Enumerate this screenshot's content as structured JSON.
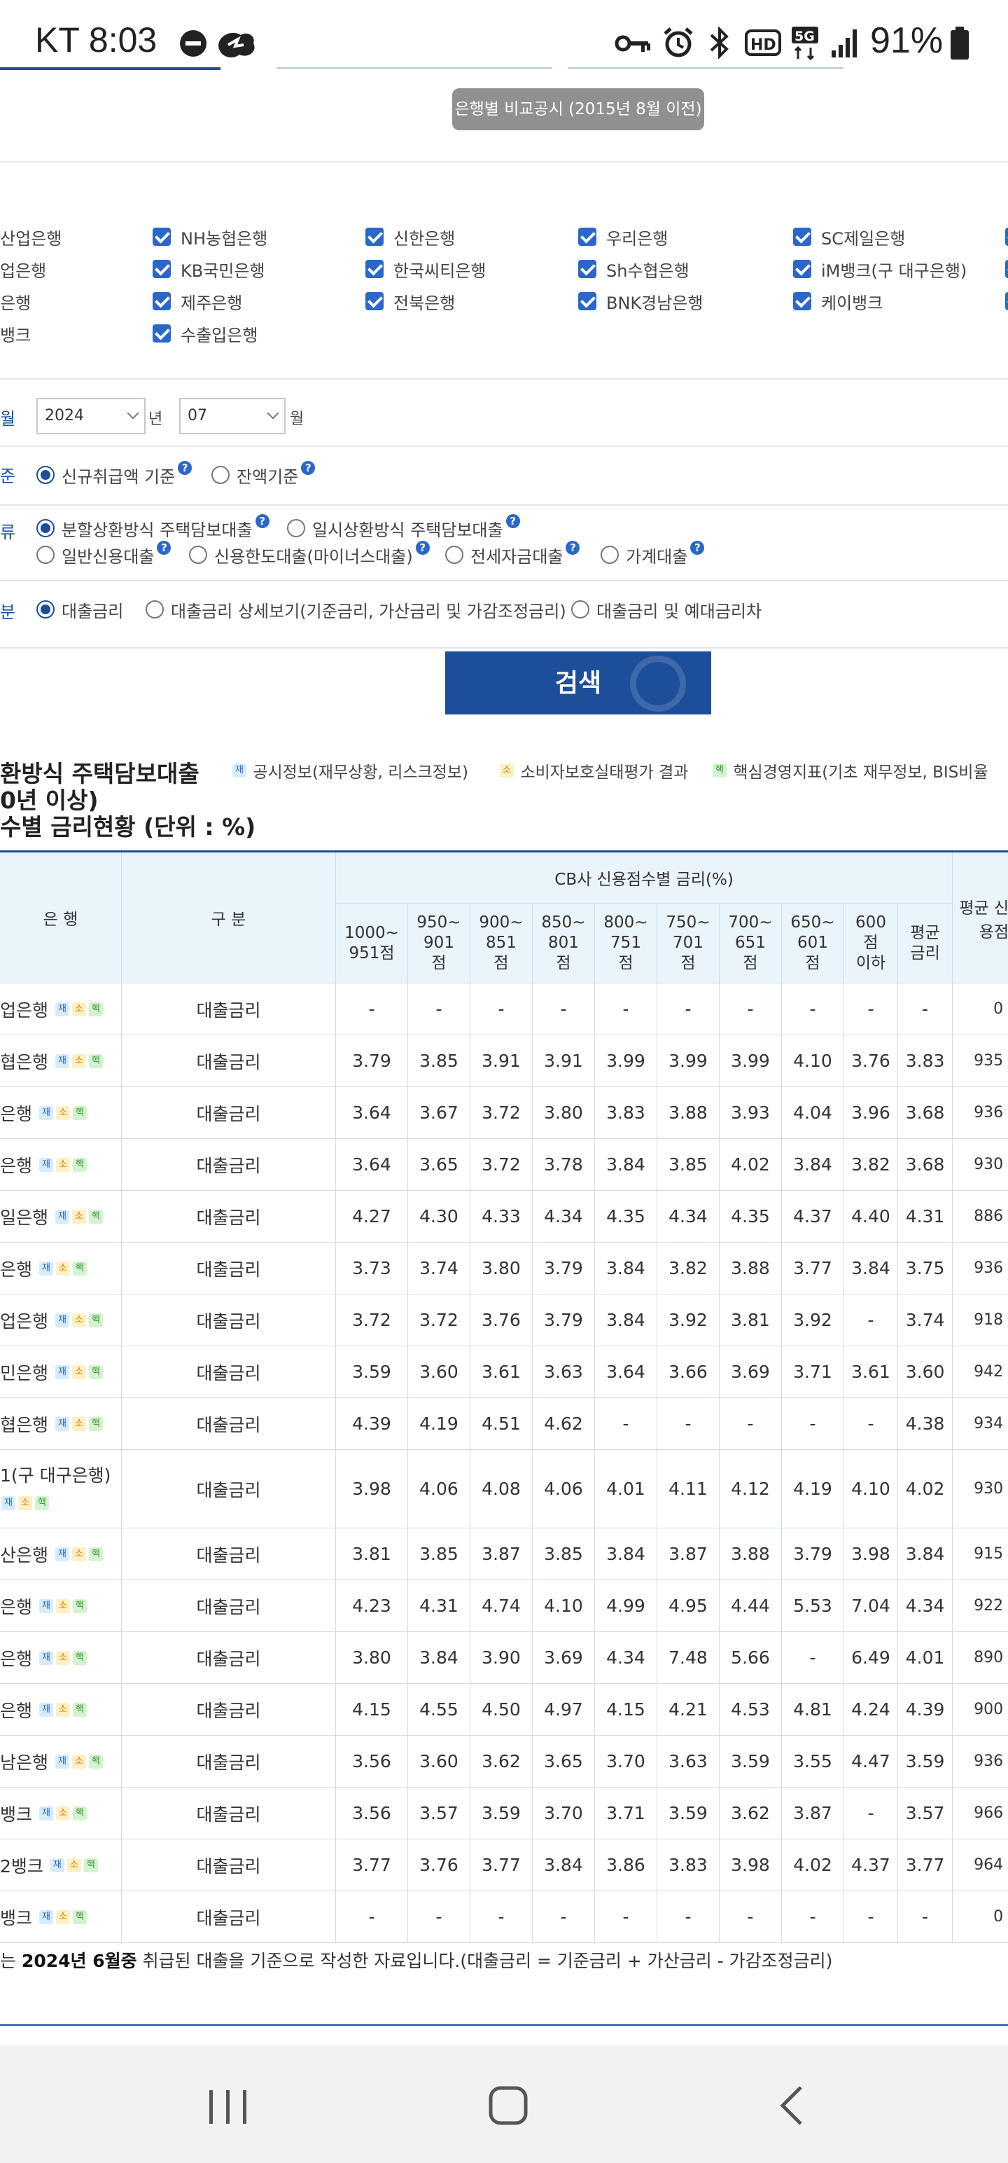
{
  "status_bar": {
    "carrier_time": "KT 8:03",
    "battery": "91%",
    "network": "5G"
  },
  "compare_badge": "은행별 비교공시 (2015년 8월 이전)",
  "banks": [
    [
      "산업은행",
      "NH농협은행",
      "신한은행",
      "우리은행",
      "SC제일은행"
    ],
    [
      "기업은행",
      "KB국민은행",
      "한국씨티은행",
      "Sh수협은행",
      "iM뱅크(구 대구은행)"
    ],
    [
      "부산은행",
      "제주은행",
      "전북은행",
      "BNK경남은행",
      "케이뱅크"
    ],
    [
      "토스뱅크",
      "수출입은행"
    ]
  ],
  "banks_visible": [
    [
      "산업은행",
      "NH농협은행",
      "신한은행",
      "우리은행",
      "SC제일은행"
    ],
    [
      "업은행",
      "KB국민은행",
      "한국씨티은행",
      "Sh수협은행",
      "iM뱅크(구 대구은행)"
    ],
    [
      "은행",
      "제주은행",
      "전북은행",
      "BNK경남은행",
      "케이뱅크"
    ],
    [
      "뱅크",
      "수출입은행"
    ]
  ],
  "period": {
    "label": "월",
    "year": "2024",
    "year_unit": "년",
    "month": "07",
    "month_unit": "월"
  },
  "basis": {
    "label": "준",
    "options": [
      "신규취급액 기준",
      "잔액기준"
    ],
    "selected": 0
  },
  "loan_type": {
    "label": "류",
    "options": [
      "분할상환방식 주택담보대출",
      "일시상환방식 주택담보대출",
      "일반신용대출",
      "신용한도대출(마이너스대출)",
      "전세자금대출",
      "가계대출"
    ],
    "selected": 0
  },
  "division": {
    "label": "분",
    "options": [
      "대출금리",
      "대출금리 상세보기(기준금리, 가산금리 및 가감조정금리)",
      "대출금리 및 예대금리차"
    ],
    "selected": 0
  },
  "search_button": "검색",
  "result_title": {
    "line1": "환방식 주택담보대출",
    "line2": "0년 이상)",
    "line3": "수별 금리현황 (단위 : %)"
  },
  "legend": [
    {
      "tag": "재",
      "text": "공시정보(재무상황, 리스크정보)"
    },
    {
      "tag": "소",
      "text": "소비자보호실태평가 결과"
    },
    {
      "tag": "핵",
      "text": "핵심경영지표(기초 재무정보, BIS비율"
    }
  ],
  "table": {
    "col_bank": "은 행",
    "col_division": "구 분",
    "col_group": "CB사 신용점수별 금리(%)",
    "col_avg_score": "평균 신용점",
    "score_cols": [
      "1000~ 951점",
      "950~ 901 점",
      "900~ 851 점",
      "850~ 801 점",
      "800~ 751 점",
      "750~ 701 점",
      "700~ 651 점",
      "650~ 601 점",
      "600 점 이하",
      "평균 금리"
    ],
    "rows": [
      {
        "bank": "업은행",
        "div": "대출금리",
        "v": [
          "-",
          "-",
          "-",
          "-",
          "-",
          "-",
          "-",
          "-",
          "-",
          "-"
        ],
        "score": "0"
      },
      {
        "bank": "협은행",
        "div": "대출금리",
        "v": [
          "3.79",
          "3.85",
          "3.91",
          "3.91",
          "3.99",
          "3.99",
          "3.99",
          "4.10",
          "3.76",
          "3.83"
        ],
        "score": "935"
      },
      {
        "bank": "은행",
        "div": "대출금리",
        "v": [
          "3.64",
          "3.67",
          "3.72",
          "3.80",
          "3.83",
          "3.88",
          "3.93",
          "4.04",
          "3.96",
          "3.68"
        ],
        "score": "936"
      },
      {
        "bank": "은행",
        "div": "대출금리",
        "v": [
          "3.64",
          "3.65",
          "3.72",
          "3.78",
          "3.84",
          "3.85",
          "4.02",
          "3.84",
          "3.82",
          "3.68"
        ],
        "score": "930"
      },
      {
        "bank": "일은행",
        "div": "대출금리",
        "v": [
          "4.27",
          "4.30",
          "4.33",
          "4.34",
          "4.35",
          "4.34",
          "4.35",
          "4.37",
          "4.40",
          "4.31"
        ],
        "score": "886"
      },
      {
        "bank": "은행",
        "div": "대출금리",
        "v": [
          "3.73",
          "3.74",
          "3.80",
          "3.79",
          "3.84",
          "3.82",
          "3.88",
          "3.77",
          "3.84",
          "3.75"
        ],
        "score": "936"
      },
      {
        "bank": "업은행",
        "div": "대출금리",
        "v": [
          "3.72",
          "3.72",
          "3.76",
          "3.79",
          "3.84",
          "3.92",
          "3.81",
          "3.92",
          "-",
          "3.74"
        ],
        "score": "918"
      },
      {
        "bank": "민은행",
        "div": "대출금리",
        "v": [
          "3.59",
          "3.60",
          "3.61",
          "3.63",
          "3.64",
          "3.66",
          "3.69",
          "3.71",
          "3.61",
          "3.60"
        ],
        "score": "942"
      },
      {
        "bank": "협은행",
        "div": "대출금리",
        "v": [
          "4.39",
          "4.19",
          "4.51",
          "4.62",
          "-",
          "-",
          "-",
          "-",
          "-",
          "4.38"
        ],
        "score": "934"
      },
      {
        "bank": "1(구 대구은행)",
        "div": "대출금리",
        "v": [
          "3.98",
          "4.06",
          "4.08",
          "4.06",
          "4.01",
          "4.11",
          "4.12",
          "4.19",
          "4.10",
          "4.02"
        ],
        "score": "930",
        "tall": true
      },
      {
        "bank": "산은행",
        "div": "대출금리",
        "v": [
          "3.81",
          "3.85",
          "3.87",
          "3.85",
          "3.84",
          "3.87",
          "3.88",
          "3.79",
          "3.98",
          "3.84"
        ],
        "score": "915"
      },
      {
        "bank": "은행",
        "div": "대출금리",
        "v": [
          "4.23",
          "4.31",
          "4.74",
          "4.10",
          "4.99",
          "4.95",
          "4.44",
          "5.53",
          "7.04",
          "4.34"
        ],
        "score": "922"
      },
      {
        "bank": "은행",
        "div": "대출금리",
        "v": [
          "3.80",
          "3.84",
          "3.90",
          "3.69",
          "4.34",
          "7.48",
          "5.66",
          "-",
          "6.49",
          "4.01"
        ],
        "score": "890"
      },
      {
        "bank": "은행",
        "div": "대출금리",
        "v": [
          "4.15",
          "4.55",
          "4.50",
          "4.97",
          "4.15",
          "4.21",
          "4.53",
          "4.81",
          "4.24",
          "4.39"
        ],
        "score": "900"
      },
      {
        "bank": "남은행",
        "div": "대출금리",
        "v": [
          "3.56",
          "3.60",
          "3.62",
          "3.65",
          "3.70",
          "3.63",
          "3.59",
          "3.55",
          "4.47",
          "3.59"
        ],
        "score": "936"
      },
      {
        "bank": "뱅크",
        "div": "대출금리",
        "v": [
          "3.56",
          "3.57",
          "3.59",
          "3.70",
          "3.71",
          "3.59",
          "3.62",
          "3.87",
          "-",
          "3.57"
        ],
        "score": "966"
      },
      {
        "bank": "2뱅크",
        "div": "대출금리",
        "v": [
          "3.77",
          "3.76",
          "3.77",
          "3.84",
          "3.86",
          "3.83",
          "3.98",
          "4.02",
          "4.37",
          "3.77"
        ],
        "score": "964"
      },
      {
        "bank": "뱅크",
        "div": "대출금리",
        "v": [
          "-",
          "-",
          "-",
          "-",
          "-",
          "-",
          "-",
          "-",
          "-",
          "-"
        ],
        "score": "0"
      }
    ]
  },
  "tags": {
    "a": "재",
    "b": "소",
    "c": "핵"
  },
  "footnote": {
    "pre": "는 ",
    "bold": "2024년 6월중",
    "post": " 취급된 대출을 기준으로 작성한 자료입니다.(대출금리 = 기준금리 + 가산금리 - 가감조정금리)"
  },
  "colors": {
    "primary": "#1d4e9a",
    "checkbox": "#2a67c9",
    "header_bg": "#eaf4fb"
  }
}
